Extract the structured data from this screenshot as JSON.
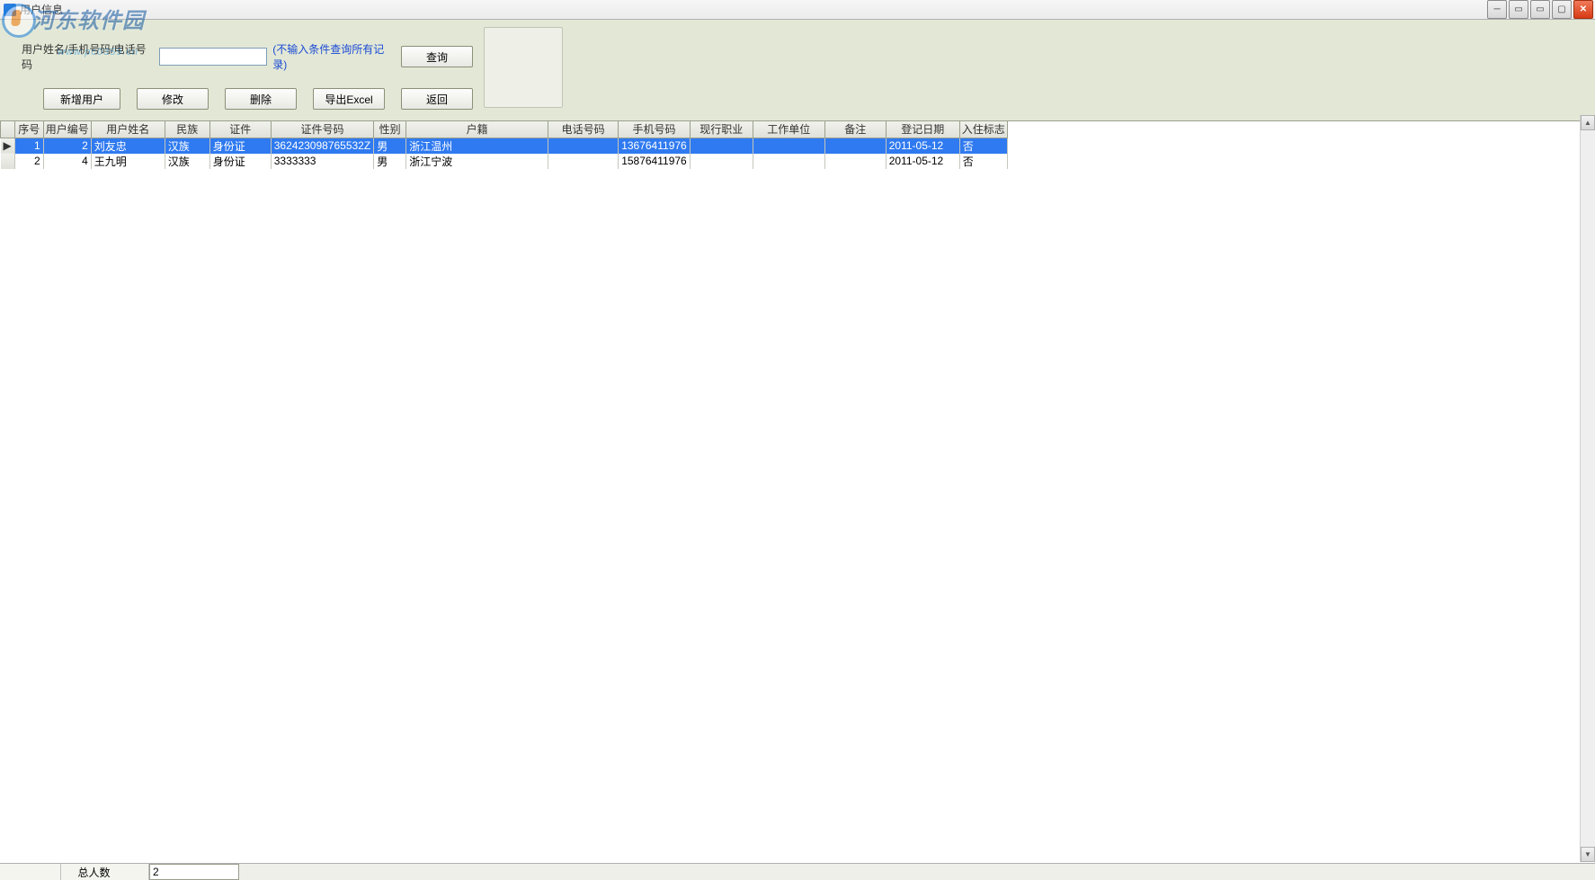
{
  "window": {
    "title": "用户信息",
    "watermark_text": "河东软件园",
    "watermark_url": "www.pc0359.cn"
  },
  "toolbar": {
    "search_label": "用户姓名/手机号码/电话号码",
    "search_value": "",
    "search_hint": "(不输入条件查询所有记录)",
    "btn_query": "查询",
    "btn_add": "新增用户",
    "btn_edit": "修改",
    "btn_delete": "删除",
    "btn_export": "导出Excel",
    "btn_back": "返回"
  },
  "table": {
    "headers": {
      "seq": "序号",
      "uid": "用户编号",
      "name": "用户姓名",
      "ethnic": "民族",
      "idtype": "证件",
      "idno": "证件号码",
      "sex": "性别",
      "origin": "户籍",
      "tel": "电话号码",
      "mobile": "手机号码",
      "job": "现行职业",
      "work": "工作单位",
      "remark": "备注",
      "reg": "登记日期",
      "flag": "入住标志"
    },
    "rows": [
      {
        "selected": true,
        "marker": "▶",
        "seq": "1",
        "uid": "2",
        "name": "刘友忠",
        "ethnic": "汉族",
        "idtype": "身份证",
        "idno": "362423098765532Z",
        "sex": "男",
        "origin": "浙江温州",
        "tel": "",
        "mobile": "13676411976",
        "job": "",
        "work": "",
        "remark": "",
        "reg": "2011-05-12",
        "flag": "否"
      },
      {
        "selected": false,
        "marker": "",
        "seq": "2",
        "uid": "4",
        "name": "王九明",
        "ethnic": "汉族",
        "idtype": "身份证",
        "idno": "3333333",
        "sex": "男",
        "origin": "浙江宁波",
        "tel": "",
        "mobile": "15876411976",
        "job": "",
        "work": "",
        "remark": "",
        "reg": "2011-05-12",
        "flag": "否"
      }
    ]
  },
  "statusbar": {
    "total_label": "总人数",
    "total_value": "2"
  }
}
